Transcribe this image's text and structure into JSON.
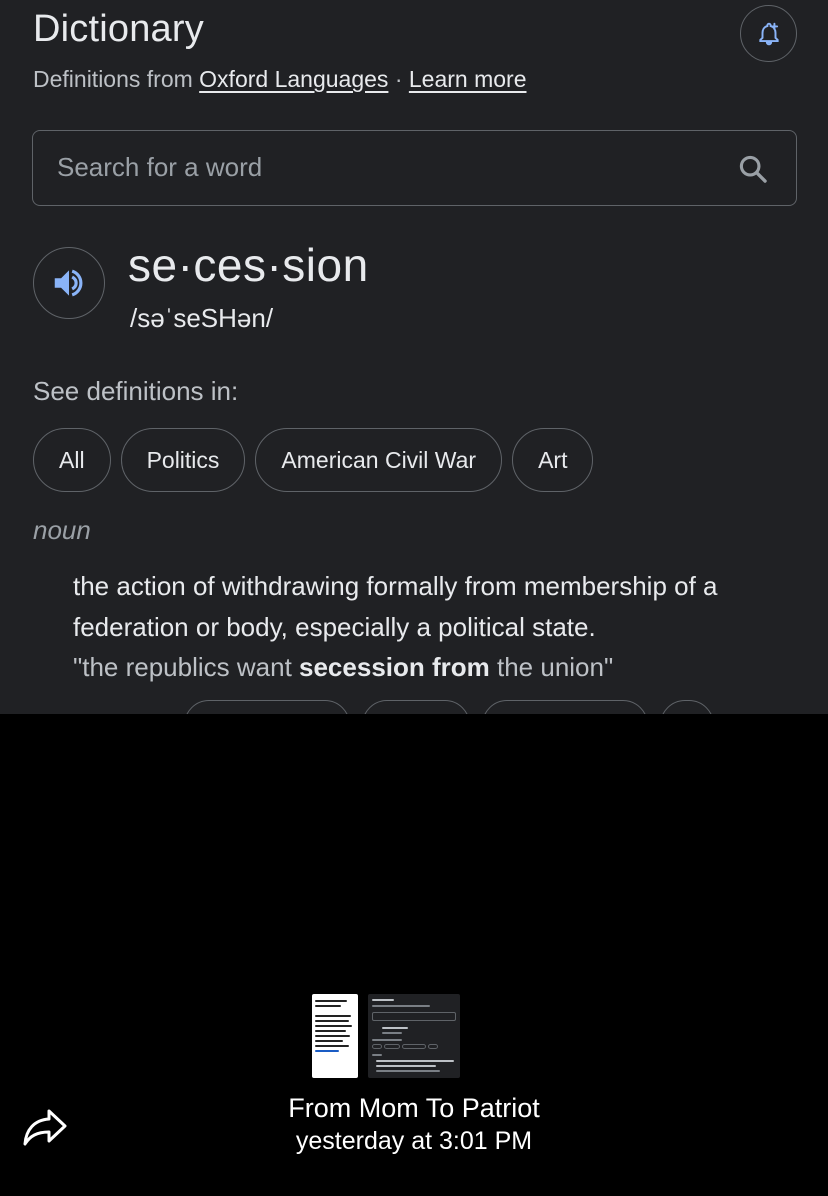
{
  "dictionary": {
    "title": "Dictionary",
    "subtitle_prefix": "Definitions from",
    "source_link": "Oxford Languages",
    "separator": "·",
    "learn_more": "Learn more",
    "search_placeholder": "Search for a word",
    "headword": "se·ces·sion",
    "phonetic": "/səˈseSHən/",
    "see_definitions_label": "See definitions in:",
    "chips": [
      "All",
      "Politics",
      "American Civil War",
      "Art"
    ],
    "part_of_speech": "noun",
    "definition": "the action of withdrawing formally from membership of a federation or body, especially a political state.",
    "example": {
      "prefix": "\"the republics want ",
      "bold": "secession from",
      "suffix": " the union\""
    },
    "icons": {
      "bell": "bell-plus-icon",
      "search": "search-icon",
      "audio": "speaker-icon"
    }
  },
  "message": {
    "sender": "From Mom To Patriot",
    "timestamp": "yesterday at 3:01 PM",
    "share_icon": "share-arrow-icon"
  },
  "colors": {
    "panel_bg": "#202124",
    "page_bg": "#000000",
    "accent": "#8ab4f8",
    "border": "#5f6368",
    "text": "#e8eaed",
    "muted": "#bdc1c6"
  }
}
